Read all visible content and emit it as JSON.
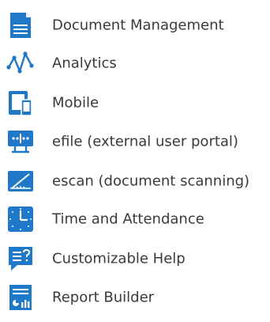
{
  "theme": {
    "icon_color": "#1f78c8",
    "text_color": "#3a3a3c",
    "background": "#ffffff"
  },
  "features": [
    {
      "label": "Document Management",
      "icon": "document-icon"
    },
    {
      "label": "Analytics",
      "icon": "analytics-icon"
    },
    {
      "label": "Mobile",
      "icon": "mobile-icon"
    },
    {
      "label": "efile (external user portal)",
      "icon": "portal-icon"
    },
    {
      "label": "escan (document scanning)",
      "icon": "scan-icon"
    },
    {
      "label": "Time and Attendance",
      "icon": "clock-icon"
    },
    {
      "label": "Customizable Help",
      "icon": "help-icon"
    },
    {
      "label": "Report Builder",
      "icon": "report-icon"
    }
  ]
}
